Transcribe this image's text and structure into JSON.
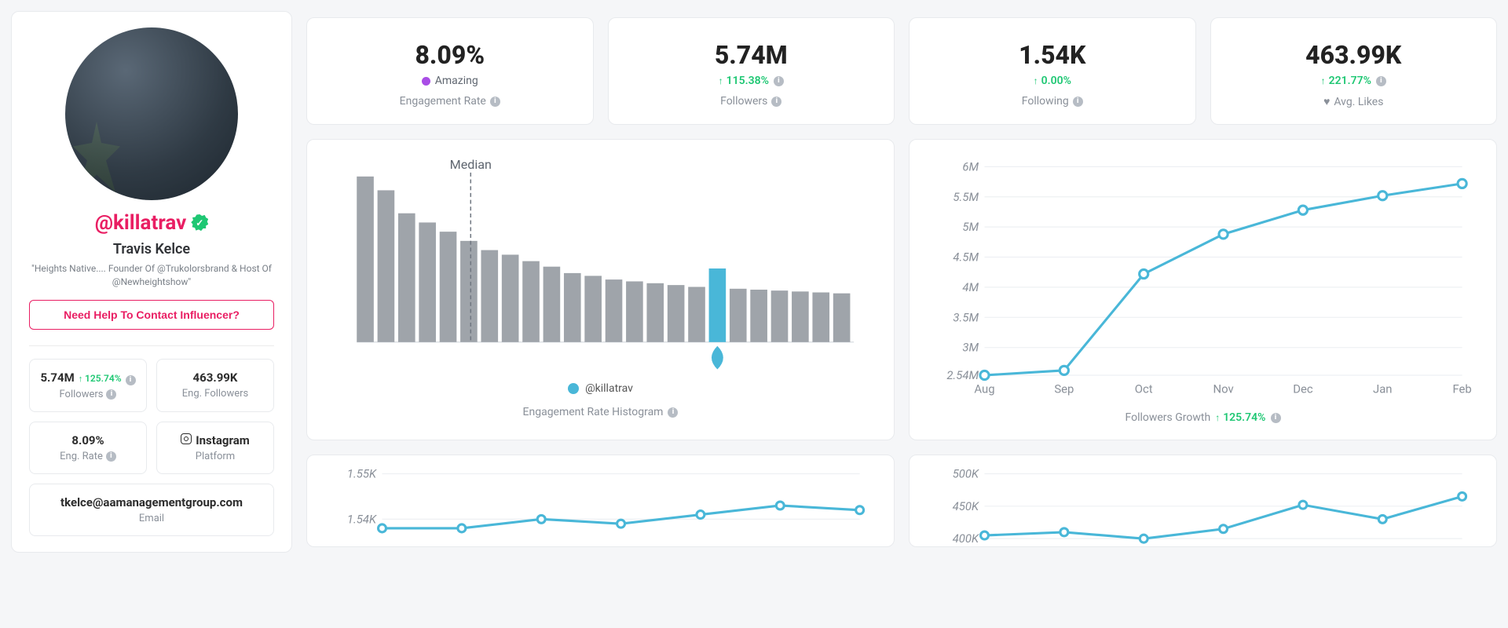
{
  "profile": {
    "handle": "@killatrav",
    "display_name": "Travis Kelce",
    "bio": "\"Heights Native.... Founder Of @Trukolorsbrand & Host Of @Newheightshow\"",
    "contact_cta": "Need Help To Contact Influencer?",
    "mini_cards": {
      "followers": {
        "value": "5.74M",
        "delta": "125.74%",
        "label": "Followers"
      },
      "eng_followers": {
        "value": "463.99K",
        "label": "Eng. Followers"
      },
      "eng_rate": {
        "value": "8.09%",
        "label": "Eng. Rate"
      },
      "platform": {
        "value": "Instagram",
        "label": "Platform"
      },
      "email": {
        "value": "tkelce@aamanagementgroup.com",
        "label": "Email"
      }
    }
  },
  "top_stats": {
    "engagement_rate": {
      "value": "8.09%",
      "qualifier": "Amazing",
      "label": "Engagement Rate"
    },
    "followers": {
      "value": "5.74M",
      "delta": "115.38%",
      "label": "Followers"
    },
    "following": {
      "value": "1.54K",
      "delta": "0.00%",
      "label": "Following"
    },
    "avg_likes": {
      "value": "463.99K",
      "delta": "221.77%",
      "label": "Avg. Likes"
    }
  },
  "histogram_panel": {
    "median_label": "Median",
    "legend": "@killatrav",
    "caption": "Engagement Rate Histogram"
  },
  "growth_panel": {
    "caption": "Followers Growth",
    "delta": "125.74%"
  },
  "bottom_left": {
    "y_ticks": [
      "1.55K",
      "1.54K"
    ]
  },
  "bottom_right": {
    "y_ticks": [
      "500K",
      "450K",
      "400K"
    ]
  },
  "chart_data": [
    {
      "id": "engagement_rate_histogram",
      "type": "bar",
      "title": "Engagement Rate Histogram",
      "xlabel": "",
      "ylabel": "",
      "values": [
        180,
        165,
        140,
        130,
        120,
        110,
        100,
        95,
        88,
        82,
        75,
        72,
        68,
        66,
        64,
        62,
        60,
        80,
        58,
        57,
        56,
        55,
        54,
        53
      ],
      "highlighted_index": 17,
      "median_index": 5,
      "legend": "@killatrav"
    },
    {
      "id": "followers_growth",
      "type": "line",
      "title": "Followers Growth",
      "x": [
        "Aug",
        "Sep",
        "Oct",
        "Nov",
        "Dec",
        "Jan",
        "Feb"
      ],
      "y": [
        2.54,
        2.62,
        4.22,
        4.88,
        5.28,
        5.52,
        5.72
      ],
      "y_unit": "M",
      "ylim": [
        2.54,
        6.0
      ],
      "y_ticks": [
        2.54,
        3.0,
        3.5,
        4.0,
        4.5,
        5.0,
        5.5,
        6.0
      ]
    },
    {
      "id": "bottom_left_partial",
      "type": "line",
      "title": "",
      "x_count": 7,
      "y": [
        1.538,
        1.538,
        1.54,
        1.539,
        1.541,
        1.543,
        1.542
      ],
      "y_unit": "K",
      "ylim": [
        1.535,
        1.55
      ],
      "y_ticks": [
        1.54,
        1.55
      ]
    },
    {
      "id": "bottom_right_partial",
      "type": "line",
      "title": "",
      "x_count": 7,
      "y": [
        405,
        410,
        400,
        415,
        452,
        430,
        465
      ],
      "y_unit": "K",
      "ylim": [
        395,
        500
      ],
      "y_ticks": [
        400,
        450,
        500
      ]
    }
  ]
}
